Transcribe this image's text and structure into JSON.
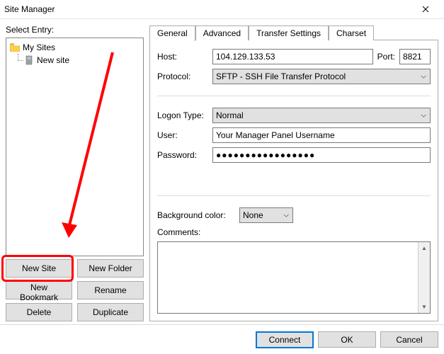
{
  "window": {
    "title": "Site Manager"
  },
  "left": {
    "select_entry_label": "Select Entry:",
    "tree_root_label": "My Sites",
    "tree_child_label": "New site"
  },
  "left_buttons": {
    "new_site": "New Site",
    "new_folder": "New Folder",
    "new_bookmark": "New Bookmark",
    "rename": "Rename",
    "delete": "Delete",
    "duplicate": "Duplicate"
  },
  "tabs": {
    "general": "General",
    "advanced": "Advanced",
    "transfer": "Transfer Settings",
    "charset": "Charset"
  },
  "general": {
    "host_label": "Host:",
    "host_value": "104.129.133.53",
    "port_label": "Port:",
    "port_value": "8821",
    "protocol_label": "Protocol:",
    "protocol_value": "SFTP - SSH File Transfer Protocol",
    "logon_type_label": "Logon Type:",
    "logon_type_value": "Normal",
    "user_label": "User:",
    "user_value": "Your Manager Panel Username",
    "password_label": "Password:",
    "password_masked": "●●●●●●●●●●●●●●●●●",
    "bgcolor_label": "Background color:",
    "bgcolor_value": "None",
    "comments_label": "Comments:"
  },
  "footer": {
    "connect": "Connect",
    "ok": "OK",
    "cancel": "Cancel"
  }
}
